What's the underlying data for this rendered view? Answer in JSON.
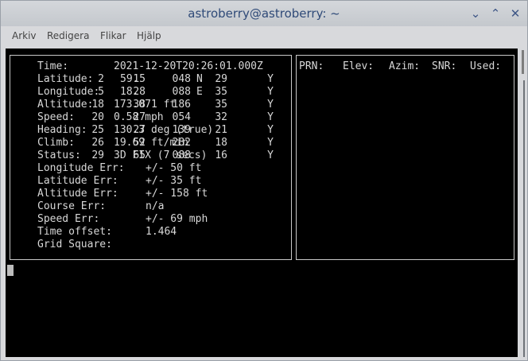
{
  "window": {
    "title": "astroberry@astroberry: ~"
  },
  "controls": {
    "minimize": "⌄",
    "maximize": "⌃",
    "close": "✕"
  },
  "menubar": [
    "Arkiv",
    "Redigera",
    "Flikar",
    "Hjälp"
  ],
  "gps_info": [
    {
      "label": "Time:",
      "value": "2021-12-20T20:26:01.000Z"
    },
    {
      "label": "Latitude:",
      "value": "59.",
      "value2": "N"
    },
    {
      "label": "Longitude:",
      "value": "18.",
      "value2": "E"
    },
    {
      "label": "Altitude:",
      "value": "173.071 ft"
    },
    {
      "label": "Speed:",
      "value": "0.58 mph"
    },
    {
      "label": "Heading:",
      "value": "130.3 deg (true)"
    },
    {
      "label": "Climb:",
      "value": "19.69 ft/min"
    },
    {
      "label": "Status:",
      "value": "3D FIX (7 secs)"
    },
    {
      "label": "Longitude Err:",
      "value": "+/- 50 ft"
    },
    {
      "label": "Latitude Err:",
      "value": "+/- 35 ft"
    },
    {
      "label": "Altitude Err:",
      "value": "+/- 158 ft"
    },
    {
      "label": "Course Err:",
      "value": "n/a"
    },
    {
      "label": "Speed Err:",
      "value": "+/- 69 mph"
    },
    {
      "label": "Time offset:",
      "value": "1.464"
    },
    {
      "label": "Grid Square:",
      "value": ""
    }
  ],
  "satellites": {
    "headers": [
      "PRN:",
      "Elev:",
      "Azim:",
      "SNR:",
      "Used:"
    ],
    "rows": [
      [
        "2",
        "15",
        "048",
        "29",
        "Y"
      ],
      [
        "5",
        "28",
        "088",
        "35",
        "Y"
      ],
      [
        "18",
        "38",
        "186",
        "35",
        "Y"
      ],
      [
        "20",
        "27",
        "054",
        "32",
        "Y"
      ],
      [
        "25",
        "27",
        "139",
        "21",
        "Y"
      ],
      [
        "26",
        "52",
        "282",
        "18",
        "Y"
      ],
      [
        "29",
        "65",
        "088",
        "16",
        "Y"
      ]
    ]
  }
}
